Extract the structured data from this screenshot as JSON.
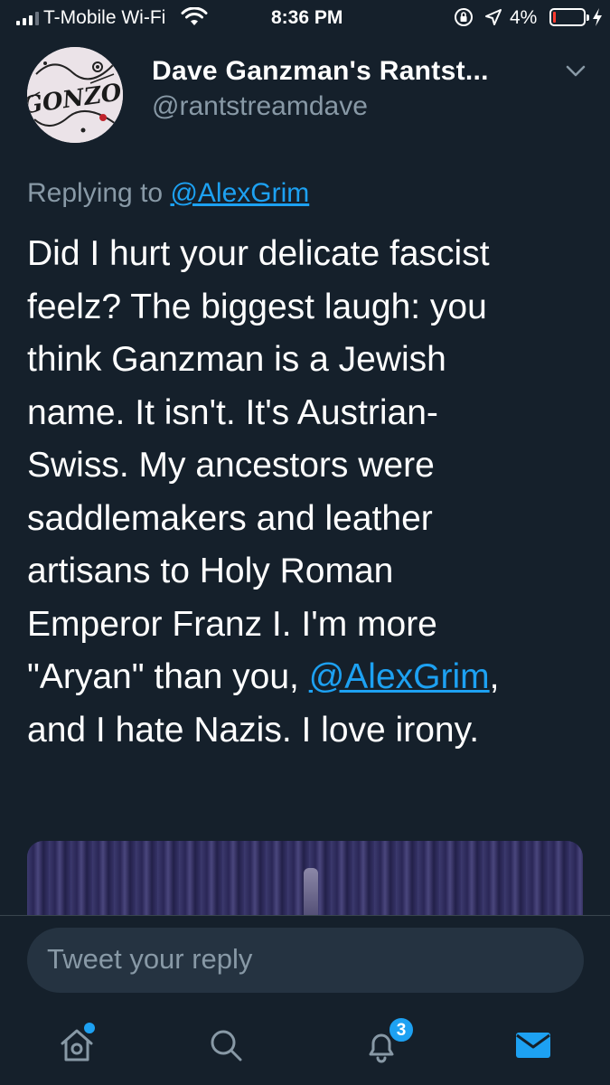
{
  "status_bar": {
    "carrier": "T-Mobile Wi-Fi",
    "time": "8:36 PM",
    "battery_percent": "4%",
    "battery_level": 0.04
  },
  "tweet": {
    "author_name": "Dave Ganzman's Rantst...",
    "author_handle": "@rantstreamdave",
    "avatar_text": "GONZO",
    "replying_prefix": "Replying to ",
    "replying_to": "@AlexGrim",
    "text_lines": [
      "Did I hurt your delicate fascist",
      "feelz? The biggest laugh: you",
      "think Ganzman is a Jewish",
      "name. It isn't. It's Austrian-",
      "Swiss. My ancestors were",
      "saddlemakers and leather",
      "artisans to Holy Roman",
      "Emperor Franz I. I'm more"
    ],
    "line9_before": "\"Aryan\" than you, ",
    "line9_mention": "@AlexGrim",
    "line9_after": ",",
    "line10": "and I hate Nazis. I love irony."
  },
  "reply": {
    "placeholder": "Tweet your reply"
  },
  "tab_bar": {
    "notifications_count": "3"
  },
  "colors": {
    "background": "#15202b",
    "accent": "#1da1f2",
    "secondary_text": "#8899a6",
    "input_bg": "#253341",
    "battery_low": "#ff3b30"
  }
}
